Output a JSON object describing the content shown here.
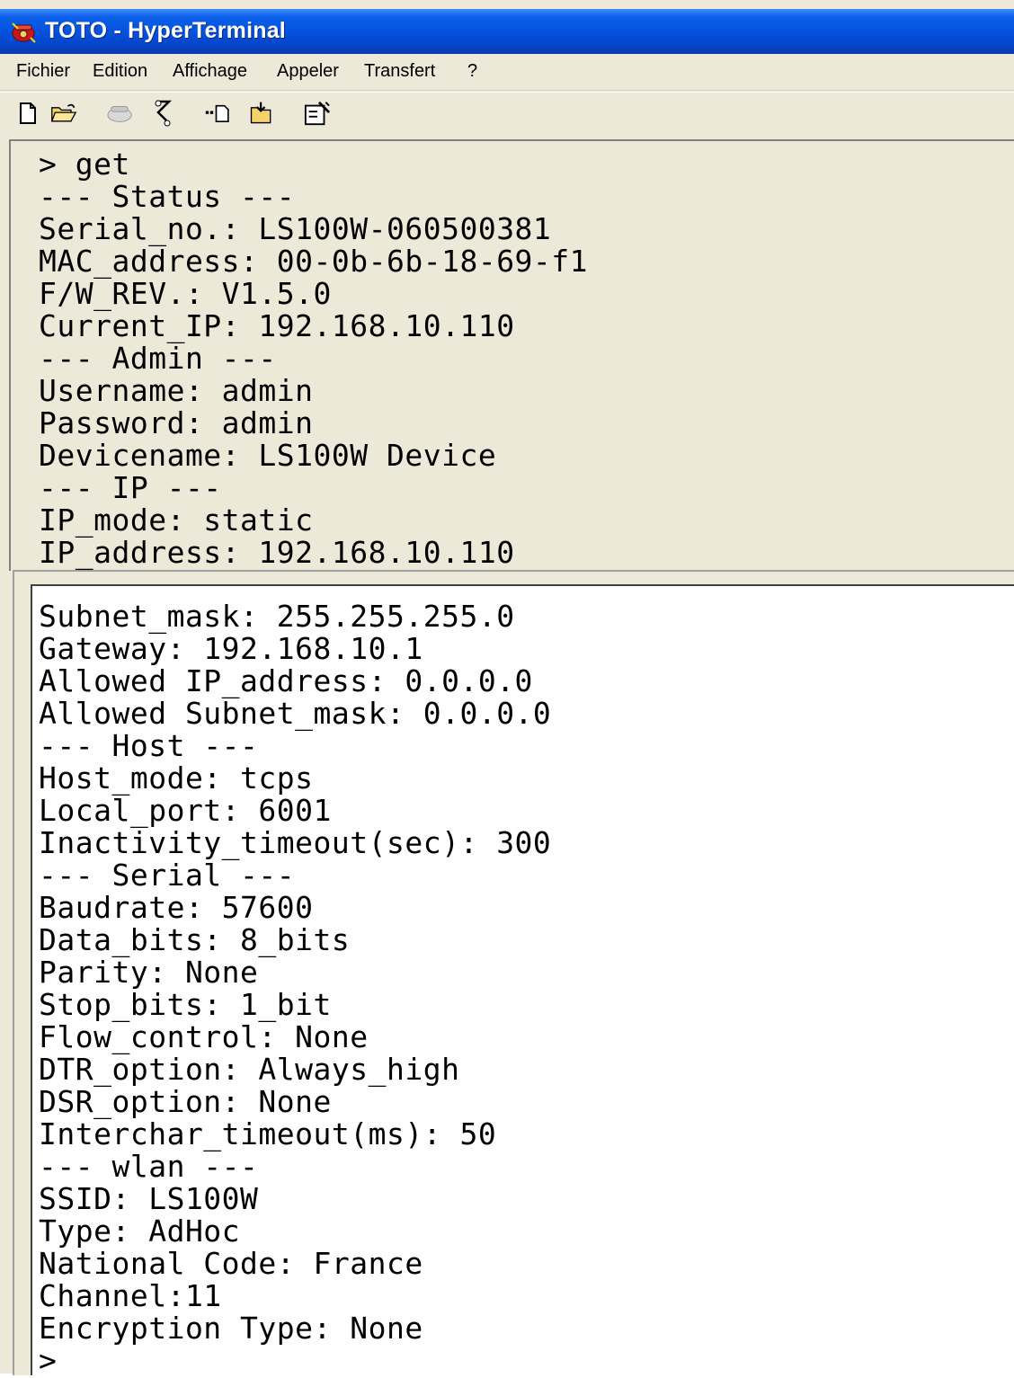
{
  "window": {
    "title": "TOTO - HyperTerminal",
    "icon": "hyperterminal-phone-icon"
  },
  "menu": {
    "items": [
      "Fichier",
      "Edition",
      "Affichage",
      "Appeler",
      "Transfert",
      "?"
    ]
  },
  "toolbar": {
    "buttons": [
      "new-document-icon",
      "open-folder-icon",
      "call-icon",
      "disconnect-icon",
      "send-file-icon",
      "receive-file-icon",
      "properties-icon"
    ]
  },
  "terminal": {
    "upper_lines": [
      "> get",
      "--- Status ---",
      "Serial_no.: LS100W-060500381",
      "MAC_address: 00-0b-6b-18-69-f1",
      "F/W_REV.: V1.5.0",
      "Current_IP: 192.168.10.110",
      "--- Admin ---",
      "Username: admin",
      "Password: admin",
      "Devicename: LS100W Device",
      "--- IP ---",
      "IP_mode: static",
      "IP_address: 192.168.10.110"
    ],
    "lower_lines": [
      "Subnet_mask: 255.255.255.0",
      "Gateway: 192.168.10.1",
      "Allowed IP_address: 0.0.0.0",
      "Allowed Subnet_mask: 0.0.0.0",
      "--- Host ---",
      "Host_mode: tcps",
      "Local_port: 6001",
      "Inactivity_timeout(sec): 300",
      "--- Serial ---",
      "Baudrate: 57600",
      "Data_bits: 8_bits",
      "Parity: None",
      "Stop_bits: 1_bit",
      "Flow_control: None",
      "DTR_option: Always_high",
      "DSR_option: None",
      "Interchar_timeout(ms): 50",
      "--- wlan ---",
      "SSID: LS100W",
      "Type: AdHoc",
      "National Code: France",
      "Channel:11",
      "Encryption Type: None",
      ">"
    ]
  }
}
